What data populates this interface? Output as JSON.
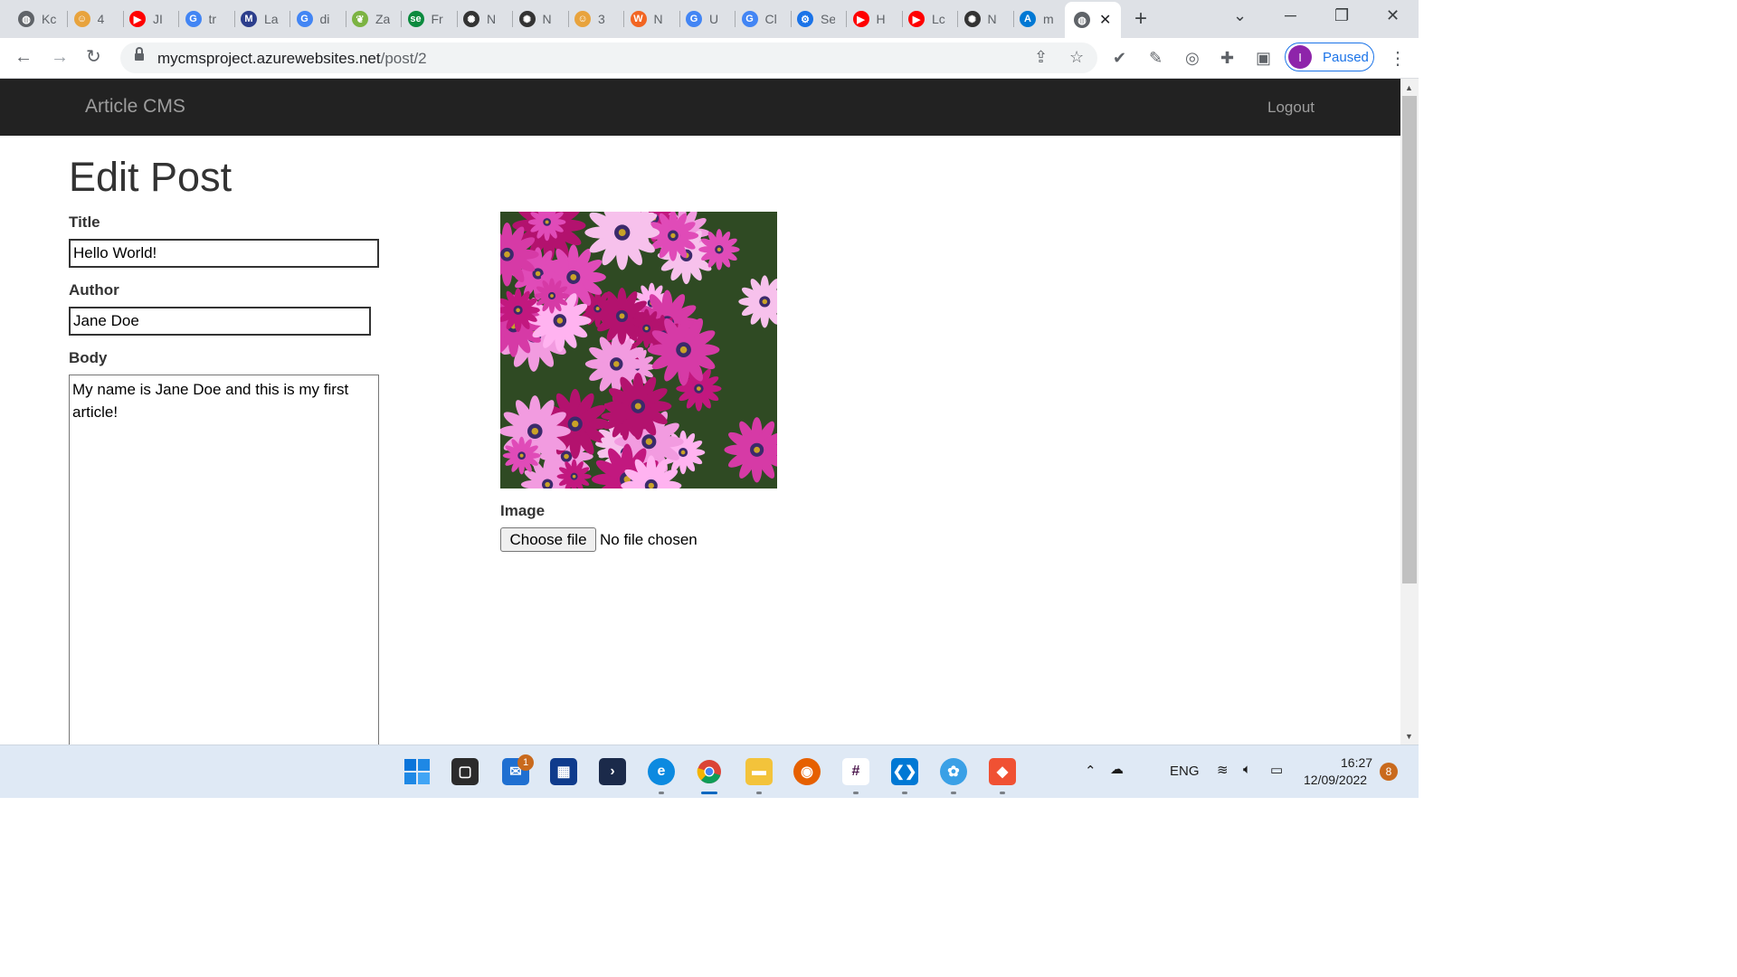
{
  "browser": {
    "tabs": [
      {
        "label": "Kc",
        "icon": "globe-icon",
        "color": "#5f6368"
      },
      {
        "label": "4",
        "icon": "face-icon",
        "color": "#e8a33d"
      },
      {
        "label": "JI",
        "icon": "youtube-icon",
        "color": "#ff0000"
      },
      {
        "label": "tr",
        "icon": "google-icon",
        "color": "#4285f4"
      },
      {
        "label": "La",
        "icon": "m-icon",
        "color": "#2c3e8c"
      },
      {
        "label": "di",
        "icon": "google-icon",
        "color": "#4285f4"
      },
      {
        "label": "Za",
        "icon": "leaf-icon",
        "color": "#7cb342"
      },
      {
        "label": "Fr",
        "icon": "se-icon",
        "color": "#0b8a3e"
      },
      {
        "label": "N",
        "icon": "openai-icon",
        "color": "#333333"
      },
      {
        "label": "N",
        "icon": "openai-icon",
        "color": "#333333"
      },
      {
        "label": "3",
        "icon": "face-icon",
        "color": "#e8a33d"
      },
      {
        "label": "N",
        "icon": "w-icon",
        "color": "#f26522"
      },
      {
        "label": "U",
        "icon": "google-icon",
        "color": "#4285f4"
      },
      {
        "label": "Cl",
        "icon": "google-icon",
        "color": "#4285f4"
      },
      {
        "label": "Se",
        "icon": "gear-icon",
        "color": "#1a73e8"
      },
      {
        "label": "H",
        "icon": "youtube-icon",
        "color": "#ff0000"
      },
      {
        "label": "Lc",
        "icon": "youtube-icon",
        "color": "#ff0000"
      },
      {
        "label": "N",
        "icon": "openai-icon",
        "color": "#333333"
      },
      {
        "label": "m",
        "icon": "azure-icon",
        "color": "#0078d4"
      }
    ],
    "url_host": "mycmsproject.azurewebsites.net",
    "url_path": "/post/2",
    "profile_initial": "I",
    "profile_status": "Paused"
  },
  "site": {
    "brand": "Article CMS",
    "logout_label": "Logout"
  },
  "form": {
    "heading": "Edit Post",
    "title_label": "Title",
    "title_value": "Hello World!",
    "author_label": "Author",
    "author_value": "Jane Doe",
    "body_label": "Body",
    "body_value": "My name is Jane Doe and this is my first article!",
    "image_label": "Image",
    "choose_file_label": "Choose file",
    "file_status": "No file chosen"
  },
  "taskbar": {
    "mail_badge": "1",
    "language": "ENG",
    "time": "16:27",
    "date": "12/09/2022",
    "notification_count": "8"
  }
}
